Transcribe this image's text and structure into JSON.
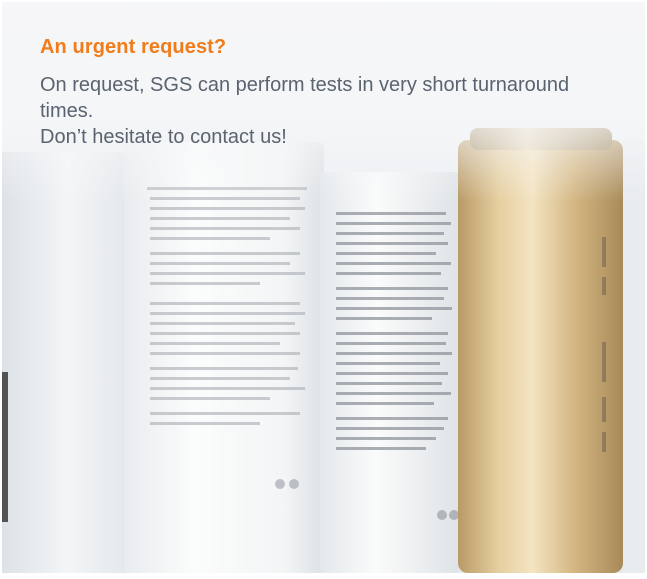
{
  "promo": {
    "heading": "An urgent request?",
    "body_line1": "On request, SGS can perform tests in very short turnaround times.",
    "body_line2": "Don’t hesitate to contact us!"
  },
  "colors": {
    "accent": "#f07c1a",
    "text": "#5a6470",
    "background": "#eceff2"
  },
  "image": {
    "subject": "cosmetic-bottles"
  }
}
